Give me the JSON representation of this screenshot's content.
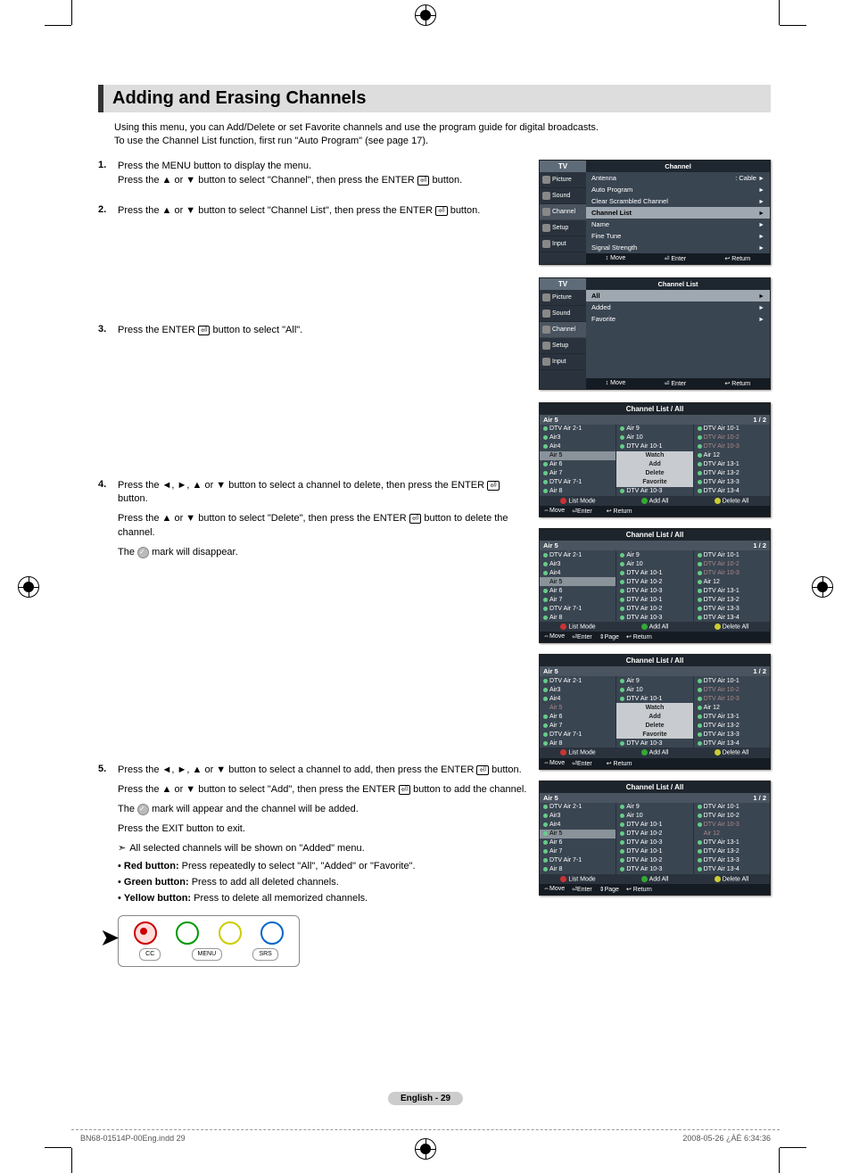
{
  "title": "Adding and Erasing Channels",
  "intro1": "Using this menu, you can Add/Delete or set Favorite channels and use the program guide for digital broadcasts.",
  "intro2": "To use the Channel List function, first run \"Auto Program\" (see page 17).",
  "steps": {
    "1a": "Press the MENU button to display the menu.",
    "1b": "Press the ▲ or ▼ button to select \"Channel\", then press the ENTER",
    "1c": " button.",
    "2a": "Press the ▲ or ▼ button to select \"Channel List\", then press the ENTER",
    "2b": " button.",
    "3a": "Press the ENTER",
    "3b": " button to select \"All\".",
    "4a": "Press the ◄, ►, ▲ or ▼ button to select a channel to delete, then press the ENTER",
    "4b": " button.",
    "4c": "Press the ▲ or ▼ button to select \"Delete\", then press the ENTER",
    "4d": " button to delete the channel.",
    "4e": "The ",
    "4f": " mark will disappear.",
    "5a": "Press the ◄, ►, ▲ or ▼ button to select a channel to add, then press the ENTER",
    "5b": " button.",
    "5c": "Press the ▲ or ▼ button to select \"Add\", then press the ENTER",
    "5d": " button to add the channel.",
    "5e": "The ",
    "5f": " mark will appear and the channel will be added.",
    "5g": "Press the EXIT button to exit.",
    "5h": "All selected channels will be shown on \"Added\" menu."
  },
  "bullets": {
    "b1_label": "Red button:",
    "b1_text": " Press repeatedly to select \"All\", \"Added\" or \"Favorite\".",
    "b2_label": "Green button:",
    "b2_text": " Press to add all deleted channels.",
    "b3_label": "Yellow button:",
    "b3_text": " Press to delete all memorized channels."
  },
  "side_items": [
    "Picture",
    "Sound",
    "Channel",
    "Setup",
    "Input"
  ],
  "osd1": {
    "tv": "TV",
    "head": "Channel",
    "rows": [
      {
        "l": "Antenna",
        "r": ": Cable"
      },
      {
        "l": "Auto Program",
        "r": ""
      },
      {
        "l": "Clear Scrambled Channel",
        "r": ""
      },
      {
        "l": "Channel List",
        "r": "",
        "sel": true
      },
      {
        "l": "Name",
        "r": ""
      },
      {
        "l": "Fine Tune",
        "r": ""
      },
      {
        "l": "Signal Strength",
        "r": ""
      }
    ],
    "footer": [
      "↕ Move",
      "⏎ Enter",
      "↩ Return"
    ]
  },
  "osd2": {
    "tv": "TV",
    "head": "Channel List",
    "rows": [
      {
        "l": "All",
        "sel": true
      },
      {
        "l": "Added"
      },
      {
        "l": "Favorite"
      }
    ],
    "footer": [
      "↕ Move",
      "⏎ Enter",
      "↩ Return"
    ]
  },
  "cl_panels": [
    {
      "title": "Channel List / All",
      "sub_left": "Air 5",
      "sub_right": "1 / 2",
      "col1": [
        {
          "t": "DTV Air 2-1"
        },
        {
          "t": "Air3"
        },
        {
          "t": "Air4"
        },
        {
          "t": "Air 5",
          "sel": true,
          "nodot": true
        },
        {
          "t": "Air 6"
        },
        {
          "t": "Air 7"
        },
        {
          "t": "DTV Air 7-1"
        },
        {
          "t": "Air 8"
        }
      ],
      "col2": [
        {
          "t": "Air 9"
        },
        {
          "t": "Air 10"
        },
        {
          "t": "DTV Air 10-1"
        },
        {
          "t": "Watch",
          "menu": true
        },
        {
          "t": "Add",
          "menu": true
        },
        {
          "t": "Delete",
          "menu": true
        },
        {
          "t": "Favorite",
          "menu": true
        },
        {
          "t": "DTV Air 10-3"
        }
      ],
      "col3": [
        {
          "t": "DTV Air 10-1"
        },
        {
          "t": "DTV Air 10-2",
          "dim": true
        },
        {
          "t": "DTV Air 10-3",
          "dim": true
        },
        {
          "t": "Air 12"
        },
        {
          "t": "DTV Air 13-1"
        },
        {
          "t": "DTV Air 13-2"
        },
        {
          "t": "DTV Air 13-3"
        },
        {
          "t": "DTV Air 13-4"
        }
      ],
      "bottoms": [
        "List Mode",
        "Add All",
        "Delete All"
      ],
      "foot": [
        "⇔Move",
        "⏎Enter",
        "",
        "↩ Return"
      ]
    },
    {
      "title": "Channel List / All",
      "sub_left": "Air 5",
      "sub_right": "1 / 2",
      "col1": [
        {
          "t": "DTV Air 2-1"
        },
        {
          "t": "Air3"
        },
        {
          "t": "Air4"
        },
        {
          "t": "Air 5",
          "sel": true,
          "nodot": true
        },
        {
          "t": "Air 6"
        },
        {
          "t": "Air 7"
        },
        {
          "t": "DTV Air 7-1"
        },
        {
          "t": "Air 8"
        }
      ],
      "col2": [
        {
          "t": "Air 9"
        },
        {
          "t": "Air 10"
        },
        {
          "t": "DTV Air 10-1"
        },
        {
          "t": "DTV Air 10-2"
        },
        {
          "t": "DTV Air 10-3"
        },
        {
          "t": "DTV Air 10-1"
        },
        {
          "t": "DTV Air 10-2"
        },
        {
          "t": "DTV Air 10-3"
        }
      ],
      "col3": [
        {
          "t": "DTV Air 10-1"
        },
        {
          "t": "DTV Air 10-2",
          "dim": true
        },
        {
          "t": "DTV Air 10-3",
          "dim": true
        },
        {
          "t": "Air 12"
        },
        {
          "t": "DTV Air 13-1"
        },
        {
          "t": "DTV Air 13-2"
        },
        {
          "t": "DTV Air 13-3"
        },
        {
          "t": "DTV Air 13-4"
        }
      ],
      "bottoms": [
        "List Mode",
        "Add All",
        "Delete All"
      ],
      "foot": [
        "⇔Move",
        "⏎Enter",
        "⇕Page",
        "↩ Return"
      ]
    },
    {
      "title": "Channel List / All",
      "sub_left": "Air 5",
      "sub_right": "1 / 2",
      "col1": [
        {
          "t": "DTV Air 2-1"
        },
        {
          "t": "Air3"
        },
        {
          "t": "Air4"
        },
        {
          "t": "Air 5",
          "dim": true,
          "nodot": true
        },
        {
          "t": "Air 6"
        },
        {
          "t": "Air 7"
        },
        {
          "t": "DTV Air 7-1"
        },
        {
          "t": "Air 8"
        }
      ],
      "col2": [
        {
          "t": "Air 9"
        },
        {
          "t": "Air 10"
        },
        {
          "t": "DTV Air 10-1"
        },
        {
          "t": "Watch",
          "menu": true
        },
        {
          "t": "Add",
          "menu": true
        },
        {
          "t": "Delete",
          "menu": true
        },
        {
          "t": "Favorite",
          "menu": true
        },
        {
          "t": "DTV Air 10-3"
        }
      ],
      "col3": [
        {
          "t": "DTV Air 10-1"
        },
        {
          "t": "DTV Air 10-2",
          "dim": true
        },
        {
          "t": "DTV Air 10-3",
          "dim": true
        },
        {
          "t": "Air 12"
        },
        {
          "t": "DTV Air 13-1"
        },
        {
          "t": "DTV Air 13-2"
        },
        {
          "t": "DTV Air 13-3"
        },
        {
          "t": "DTV Air 13-4"
        }
      ],
      "bottoms": [
        "List Mode",
        "Add All",
        "Delete All"
      ],
      "foot": [
        "⇔Move",
        "⏎Enter",
        "",
        "↩ Return"
      ]
    },
    {
      "title": "Channel List / All",
      "sub_left": "Air 5",
      "sub_right": "1 / 2",
      "col1": [
        {
          "t": "DTV Air 2-1"
        },
        {
          "t": "Air3"
        },
        {
          "t": "Air4"
        },
        {
          "t": "Air 5",
          "sel": true
        },
        {
          "t": "Air 6"
        },
        {
          "t": "Air 7"
        },
        {
          "t": "DTV Air 7-1"
        },
        {
          "t": "Air 8"
        }
      ],
      "col2": [
        {
          "t": "Air 9"
        },
        {
          "t": "Air 10"
        },
        {
          "t": "DTV Air 10-1"
        },
        {
          "t": "DTV Air 10-2"
        },
        {
          "t": "DTV Air 10-3"
        },
        {
          "t": "DTV Air 10-1"
        },
        {
          "t": "DTV Air 10-2"
        },
        {
          "t": "DTV Air 10-3"
        }
      ],
      "col3": [
        {
          "t": "DTV Air 10-1"
        },
        {
          "t": "DTV Air 10-2"
        },
        {
          "t": "DTV Air 10-3",
          "dim": true
        },
        {
          "t": "Air 12",
          "dim": true,
          "nodot": true
        },
        {
          "t": "DTV Air 13-1"
        },
        {
          "t": "DTV Air 13-2"
        },
        {
          "t": "DTV Air 13-3"
        },
        {
          "t": "DTV Air 13-4"
        }
      ],
      "bottoms": [
        "List Mode",
        "Add All",
        "Delete All"
      ],
      "foot": [
        "⇔Move",
        "⏎Enter",
        "⇕Page",
        "↩ Return"
      ]
    }
  ],
  "remote_buttons": [
    "CC",
    "MENU",
    "SRS"
  ],
  "footer_badge": "English - 29",
  "footer_left": "BN68-01514P-00Eng.indd   29",
  "footer_right": "2008-05-26   ¿ÀÈ 6:34:36"
}
